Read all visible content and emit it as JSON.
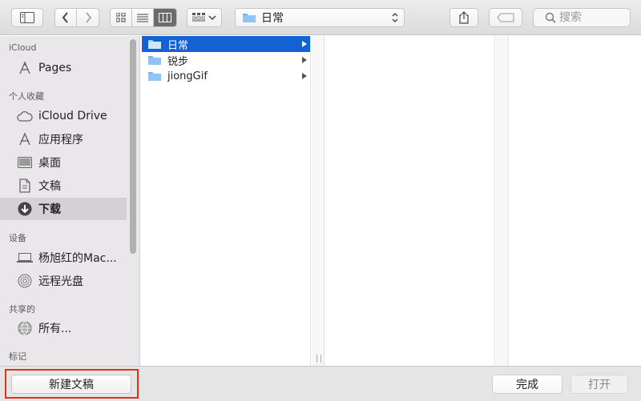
{
  "toolbar": {
    "path_label": "日常",
    "search_placeholder": "搜索"
  },
  "sidebar": {
    "sections": [
      {
        "title": "iCloud",
        "items": [
          {
            "label": "Pages",
            "icon": "pages-icon"
          }
        ]
      },
      {
        "title": "个人收藏",
        "items": [
          {
            "label": "iCloud Drive",
            "icon": "cloud-icon"
          },
          {
            "label": "应用程序",
            "icon": "applications-icon"
          },
          {
            "label": "桌面",
            "icon": "desktop-icon"
          },
          {
            "label": "文稿",
            "icon": "documents-icon"
          },
          {
            "label": "下载",
            "icon": "download-icon",
            "selected": true
          }
        ]
      },
      {
        "title": "设备",
        "items": [
          {
            "label": "杨旭红的Mac...",
            "icon": "laptop-icon"
          },
          {
            "label": "远程光盘",
            "icon": "disc-icon"
          }
        ]
      },
      {
        "title": "共享的",
        "items": [
          {
            "label": "所有...",
            "icon": "network-icon"
          }
        ]
      },
      {
        "title": "标记",
        "items": []
      }
    ]
  },
  "browser": {
    "column1": [
      {
        "label": "日常",
        "selected": true
      },
      {
        "label": "锐步",
        "selected": false
      },
      {
        "label": "jiongGif",
        "selected": false
      }
    ]
  },
  "bottom": {
    "new_doc_label": "新建文稿",
    "done_label": "完成",
    "open_label": "打开"
  },
  "colors": {
    "selection": "#1461d6",
    "folder": "#6fb3f0",
    "highlight_box": "#e0301e"
  }
}
